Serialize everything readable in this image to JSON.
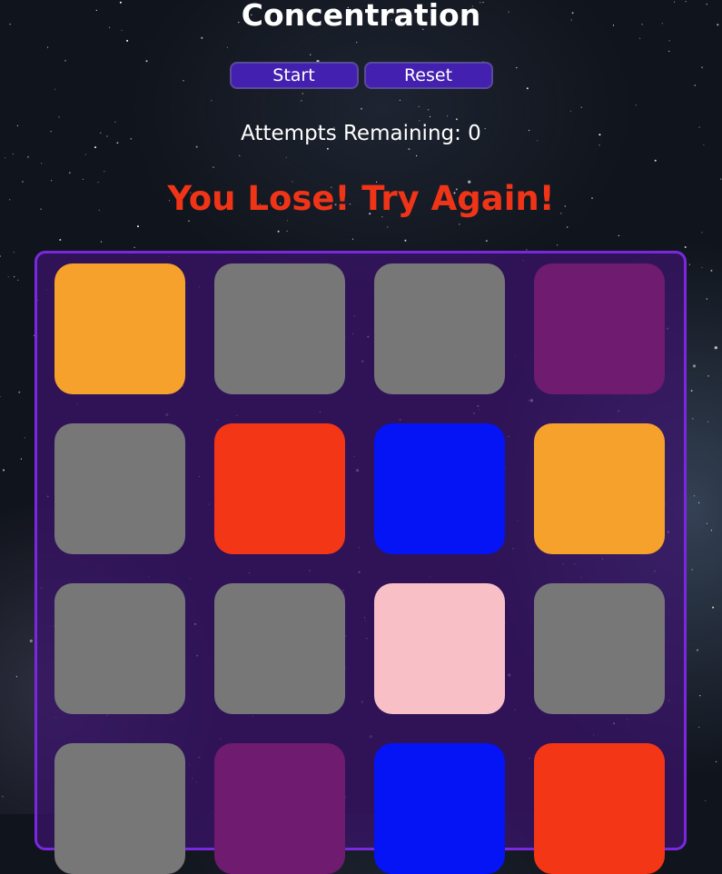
{
  "title": "Concentration",
  "controls": {
    "start_label": "Start",
    "reset_label": "Reset"
  },
  "attempts": {
    "text": "Attempts Remaining: 0"
  },
  "status": {
    "text": "You Lose! Try Again!"
  },
  "colors": {
    "button": "#4420b0",
    "status_text": "#f03417",
    "board_border": "#7a28e0",
    "hidden_card": "#777777"
  },
  "cards": [
    {
      "state": "revealed",
      "color": "#f6a12b"
    },
    {
      "state": "hidden",
      "color": "#777777"
    },
    {
      "state": "hidden",
      "color": "#777777"
    },
    {
      "state": "revealed",
      "color": "#6e1b70"
    },
    {
      "state": "hidden",
      "color": "#777777"
    },
    {
      "state": "revealed",
      "color": "#f23616"
    },
    {
      "state": "revealed",
      "color": "#0414f4"
    },
    {
      "state": "revealed",
      "color": "#f6a12b"
    },
    {
      "state": "hidden",
      "color": "#777777"
    },
    {
      "state": "hidden",
      "color": "#777777"
    },
    {
      "state": "revealed",
      "color": "#f9bfc7"
    },
    {
      "state": "hidden",
      "color": "#777777"
    },
    {
      "state": "hidden",
      "color": "#777777"
    },
    {
      "state": "revealed",
      "color": "#6e1b70"
    },
    {
      "state": "revealed",
      "color": "#0414f4"
    },
    {
      "state": "revealed",
      "color": "#f23616"
    }
  ]
}
